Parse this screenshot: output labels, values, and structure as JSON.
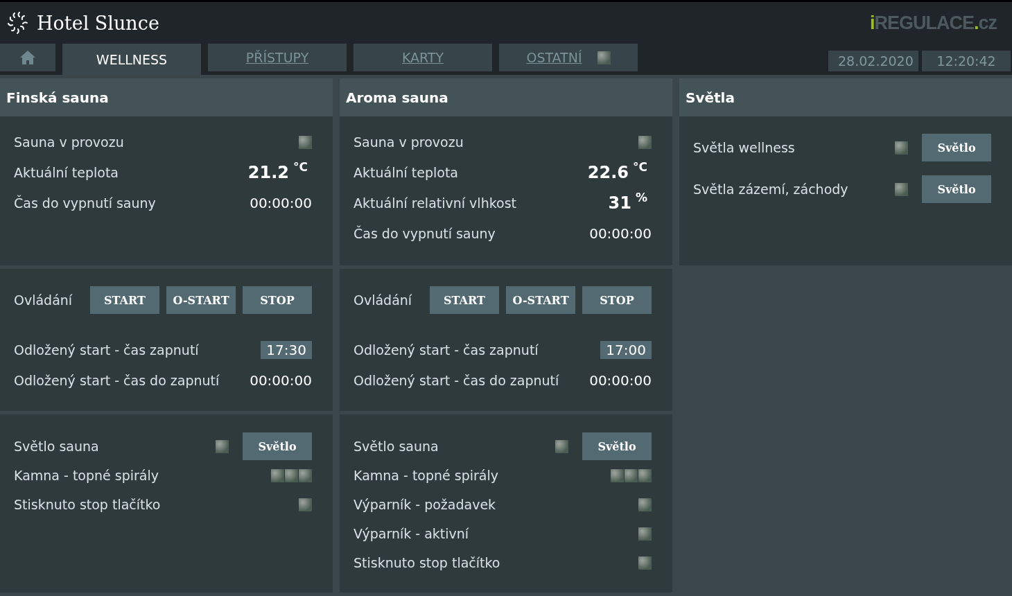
{
  "header": {
    "title": "Hotel Slunce",
    "logo": [
      {
        "text": "i",
        "accent": true
      },
      {
        "text": "REGULACE",
        "accent": false
      },
      {
        "text": ".",
        "accent": true
      },
      {
        "text": "cz",
        "accent": false
      }
    ]
  },
  "tabs": [
    {
      "kind": "home",
      "selected": false
    },
    {
      "kind": "text",
      "label": "WELLNESS",
      "selected": true
    },
    {
      "kind": "text",
      "label": "PŘÍSTUPY",
      "selected": false
    },
    {
      "kind": "text",
      "label": "KARTY",
      "selected": false
    },
    {
      "kind": "text",
      "label": "OSTATNÍ",
      "selected": false,
      "indicator": {
        "on": false
      }
    }
  ],
  "date": "28.02.2020",
  "time": "12:20:42",
  "columns": [
    {
      "title": "Finská sauna",
      "sections": [
        [
          {
            "kind": "indicator",
            "label": "Sauna v provozu",
            "indicators": [
              {
                "on": false
              }
            ]
          },
          {
            "kind": "measure",
            "label": "Aktuální teplota",
            "value": "21.2",
            "unit": "°C"
          },
          {
            "kind": "value",
            "label": "Čas do vypnutí sauny",
            "value": "00:00:00"
          }
        ],
        [
          {
            "kind": "buttons",
            "label": "Ovládání",
            "buttons": [
              "START",
              "O-START",
              "STOP"
            ]
          },
          {
            "kind": "setpoint",
            "label": "Odložený start - čas zapnutí",
            "value": "17:30"
          },
          {
            "kind": "value",
            "label": "Odložený start - čas do zapnutí",
            "value": "00:00:00"
          }
        ],
        [
          {
            "kind": "light",
            "label": "Světlo sauna",
            "indicators": [
              {
                "on": false
              }
            ],
            "button": "Světlo"
          },
          {
            "kind": "indicator",
            "label": "Kamna - topné spirály",
            "indicators": [
              {
                "on": false
              },
              {
                "on": false
              },
              {
                "on": false
              }
            ]
          },
          {
            "kind": "indicator",
            "label": "Stisknuto stop tlačítko",
            "indicators": [
              {
                "on": false
              }
            ]
          }
        ]
      ]
    },
    {
      "title": "Aroma sauna",
      "sections": [
        [
          {
            "kind": "indicator",
            "label": "Sauna v provozu",
            "indicators": [
              {
                "on": false
              }
            ]
          },
          {
            "kind": "measure",
            "label": "Aktuální teplota",
            "value": "22.6",
            "unit": "°C"
          },
          {
            "kind": "measure",
            "label": "Aktuální relativní vlhkost",
            "value": "31",
            "unit": "%"
          },
          {
            "kind": "value",
            "label": "Čas do vypnutí sauny",
            "value": "00:00:00"
          }
        ],
        [
          {
            "kind": "buttons",
            "label": "Ovládání",
            "buttons": [
              "START",
              "O-START",
              "STOP"
            ]
          },
          {
            "kind": "setpoint",
            "label": "Odložený start - čas zapnutí",
            "value": "17:00"
          },
          {
            "kind": "value",
            "label": "Odložený start - čas do zapnutí",
            "value": "00:00:00"
          }
        ],
        [
          {
            "kind": "light",
            "label": "Světlo sauna",
            "indicators": [
              {
                "on": false
              }
            ],
            "button": "Světlo"
          },
          {
            "kind": "indicator",
            "label": "Kamna - topné spirály",
            "indicators": [
              {
                "on": false
              },
              {
                "on": false
              },
              {
                "on": false
              }
            ]
          },
          {
            "kind": "indicator",
            "label": "Výparník - požadavek",
            "indicators": [
              {
                "on": false
              }
            ]
          },
          {
            "kind": "indicator",
            "label": "Výparník - aktivní",
            "indicators": [
              {
                "on": false
              }
            ]
          },
          {
            "kind": "indicator",
            "label": "Stisknuto stop tlačítko",
            "indicators": [
              {
                "on": false
              }
            ]
          }
        ]
      ]
    },
    {
      "title": "Světla",
      "sections": [
        [
          {
            "kind": "light",
            "label": "Světla wellness",
            "indicators": [
              {
                "on": false
              }
            ],
            "button": "Světlo"
          },
          {
            "kind": "light",
            "label": "Světla zázemí, záchody",
            "indicators": [
              {
                "on": false
              }
            ],
            "button": "Světlo"
          }
        ]
      ]
    }
  ]
}
